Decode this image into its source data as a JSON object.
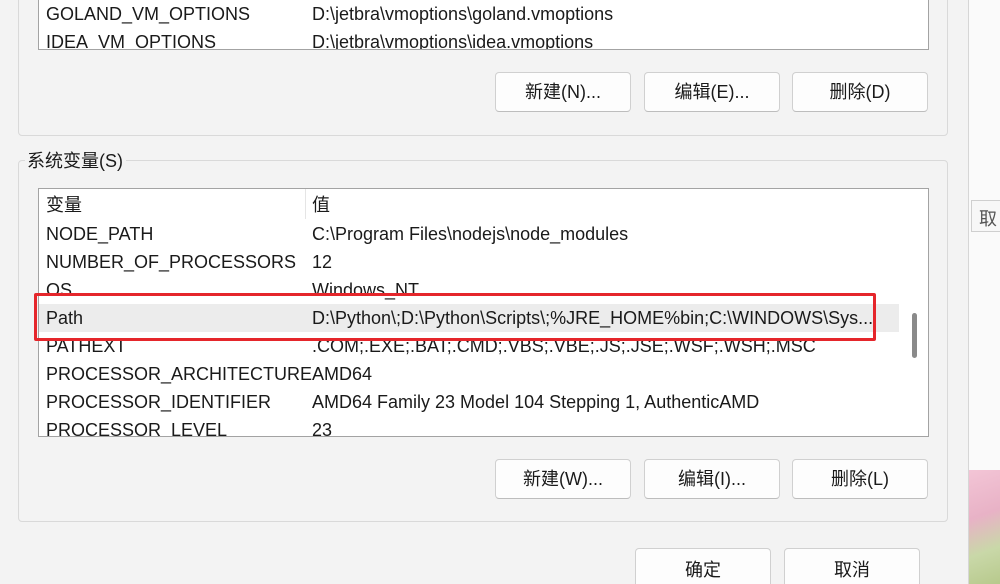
{
  "user_vars": {
    "rows": [
      {
        "name": "GOLAND_VM_OPTIONS",
        "value": "D:\\jetbra\\vmoptions\\goland.vmoptions"
      },
      {
        "name": "IDEA_VM_OPTIONS",
        "value": "D:\\jetbra\\vmoptions\\idea.vmoptions"
      }
    ],
    "buttons": {
      "new": "新建(N)...",
      "edit": "编辑(E)...",
      "delete": "删除(D)"
    }
  },
  "system_vars": {
    "group_label": "系统变量(S)",
    "header": {
      "name": "变量",
      "value": "值"
    },
    "rows": [
      {
        "name": "NODE_PATH",
        "value": "C:\\Program Files\\nodejs\\node_modules"
      },
      {
        "name": "NUMBER_OF_PROCESSORS",
        "value": "12"
      },
      {
        "name": "OS",
        "value": "Windows_NT"
      },
      {
        "name": "Path",
        "value": "D:\\Python\\;D:\\Python\\Scripts\\;%JRE_HOME%bin;C:\\WINDOWS\\Sys..."
      },
      {
        "name": "PATHEXT",
        "value": ".COM;.EXE;.BAT;.CMD;.VBS;.VBE;.JS;.JSE;.WSF;.WSH;.MSC"
      },
      {
        "name": "PROCESSOR_ARCHITECTURE",
        "value": "AMD64"
      },
      {
        "name": "PROCESSOR_IDENTIFIER",
        "value": "AMD64 Family 23 Model 104 Stepping 1, AuthenticAMD"
      },
      {
        "name": "PROCESSOR_LEVEL",
        "value": "23"
      }
    ],
    "selected_row": "Path",
    "buttons": {
      "new": "新建(W)...",
      "edit": "编辑(I)...",
      "delete": "删除(L)"
    }
  },
  "dialog_buttons": {
    "ok": "确定",
    "cancel": "取消"
  },
  "background_window": {
    "partial_label": "取"
  },
  "colors": {
    "highlight": "#e5262b",
    "selected_row": "#ececec"
  }
}
